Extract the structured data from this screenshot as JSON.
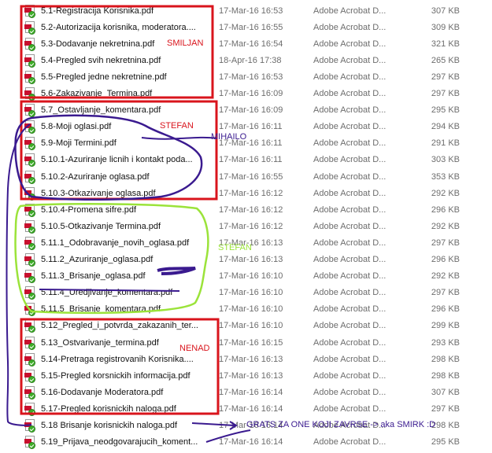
{
  "files": [
    {
      "name": "5.1-Registracija Korisnika.pdf",
      "date": "17-Mar-16 16:53",
      "type": "Adobe Acrobat D...",
      "size": "307 KB"
    },
    {
      "name": "5.2-Autorizacija korisnika, moderatora....",
      "date": "17-Mar-16 16:55",
      "type": "Adobe Acrobat D...",
      "size": "309 KB"
    },
    {
      "name": "5.3-Dodavanje nekretnina.pdf",
      "date": "17-Mar-16 16:54",
      "type": "Adobe Acrobat D...",
      "size": "321 KB"
    },
    {
      "name": "5.4-Pregled svih nekretnina.pdf",
      "date": "18-Apr-16 17:38",
      "type": "Adobe Acrobat D...",
      "size": "265 KB"
    },
    {
      "name": "5.5-Pregled jedne nekretnine.pdf",
      "date": "17-Mar-16 16:53",
      "type": "Adobe Acrobat D...",
      "size": "297 KB"
    },
    {
      "name": "5.6-Zakazivanje_Termina.pdf",
      "date": "17-Mar-16 16:09",
      "type": "Adobe Acrobat D...",
      "size": "297 KB"
    },
    {
      "name": "5.7_Ostavljanje_komentara.pdf",
      "date": "17-Mar-16 16:09",
      "type": "Adobe Acrobat D...",
      "size": "295 KB"
    },
    {
      "name": "5.8-Moji oglasi.pdf",
      "date": "17-Mar-16 16:11",
      "type": "Adobe Acrobat D...",
      "size": "294 KB"
    },
    {
      "name": "5.9-Moji Termini.pdf",
      "date": "17-Mar-16 16:11",
      "type": "Adobe Acrobat D...",
      "size": "291 KB"
    },
    {
      "name": "5.10.1-Azuriranje licnih i kontakt poda...",
      "date": "17-Mar-16 16:11",
      "type": "Adobe Acrobat D...",
      "size": "303 KB"
    },
    {
      "name": "5.10.2-Azuriranje oglasa.pdf",
      "date": "17-Mar-16 16:55",
      "type": "Adobe Acrobat D...",
      "size": "353 KB"
    },
    {
      "name": "5.10.3-Otkazivanje oglasa.pdf",
      "date": "17-Mar-16 16:12",
      "type": "Adobe Acrobat D...",
      "size": "292 KB"
    },
    {
      "name": "5.10.4-Promena sifre.pdf",
      "date": "17-Mar-16 16:12",
      "type": "Adobe Acrobat D...",
      "size": "296 KB"
    },
    {
      "name": "5.10.5-Otkazivanje Termina.pdf",
      "date": "17-Mar-16 16:12",
      "type": "Adobe Acrobat D...",
      "size": "292 KB"
    },
    {
      "name": "5.11.1_Odobravanje_novih_oglasa.pdf",
      "date": "17-Mar-16 16:13",
      "type": "Adobe Acrobat D...",
      "size": "297 KB"
    },
    {
      "name": "5.11.2_Azuriranje_oglasa.pdf",
      "date": "17-Mar-16 16:13",
      "type": "Adobe Acrobat D...",
      "size": "296 KB"
    },
    {
      "name": "5.11.3_Brisanje_oglasa.pdf",
      "date": "17-Mar-16 16:10",
      "type": "Adobe Acrobat D...",
      "size": "292 KB"
    },
    {
      "name": "5.11.4_Uredjivanje_komentara.pdf",
      "date": "17-Mar-16 16:10",
      "type": "Adobe Acrobat D...",
      "size": "297 KB"
    },
    {
      "name": "5.11.5_Brisanje_komentara.pdf",
      "date": "17-Mar-16 16:10",
      "type": "Adobe Acrobat D...",
      "size": "296 KB"
    },
    {
      "name": "5.12_Pregled_i_potvrda_zakazanih_ter...",
      "date": "17-Mar-16 16:10",
      "type": "Adobe Acrobat D...",
      "size": "299 KB"
    },
    {
      "name": "5.13_Ostvarivanje_termina.pdf",
      "date": "17-Mar-16 16:15",
      "type": "Adobe Acrobat D...",
      "size": "293 KB"
    },
    {
      "name": "5.14-Pretraga registrovanih Korisnika....",
      "date": "17-Mar-16 16:13",
      "type": "Adobe Acrobat D...",
      "size": "298 KB"
    },
    {
      "name": "5.15-Pregled korsnickih informacija.pdf",
      "date": "17-Mar-16 16:13",
      "type": "Adobe Acrobat D...",
      "size": "298 KB"
    },
    {
      "name": "5.16-Dodavanje Moderatora.pdf",
      "date": "17-Mar-16 16:14",
      "type": "Adobe Acrobat D...",
      "size": "307 KB"
    },
    {
      "name": "5.17-Pregled korisnickih naloga.pdf",
      "date": "17-Mar-16 16:14",
      "type": "Adobe Acrobat D...",
      "size": "297 KB"
    },
    {
      "name": "5.18 Brisanje korisnickih naloga.pdf",
      "date": "17-Mar-16 16:14",
      "type": "Adobe Acrobat D...",
      "size": "298 KB"
    },
    {
      "name": "5.19_Prijava_neodgovarajucih_koment...",
      "date": "17-Mar-16 16:14",
      "type": "Adobe Acrobat D...",
      "size": "295 KB"
    }
  ],
  "annotations": {
    "smiljan": "SMILJAN",
    "stefan_scribble": "STEFAN",
    "mihailo": "MIHAILO",
    "stefan": "STEFAN",
    "nenad": "NENAD",
    "grats": "GRATS ZA ONE KOJI ZAVRSE -> aka SMIRK :D"
  },
  "colors": {
    "red_box": "#d9141c",
    "purple_pen": "#3a1a8f",
    "green_pen": "#9be33a",
    "pdf_red": "#c8102e"
  }
}
